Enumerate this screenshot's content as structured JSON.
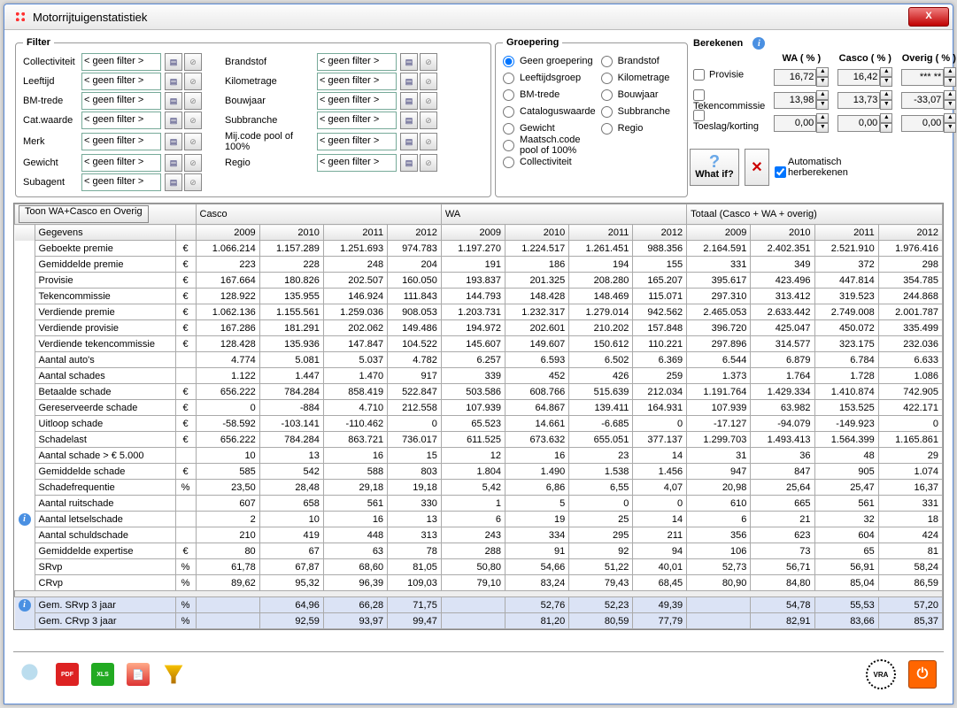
{
  "window": {
    "title": "Motorrijtuigenstatistiek"
  },
  "filter": {
    "legend": "Filter",
    "none": "< geen filter >",
    "left": [
      "Collectiviteit",
      "Leeftijd",
      "BM-trede",
      "Cat.waarde",
      "Merk",
      "Gewicht",
      "Subagent"
    ],
    "right": [
      "Brandstof",
      "Kilometrage",
      "Bouwjaar",
      "Subbranche",
      "Mij.code pool of 100%",
      "Regio"
    ]
  },
  "group": {
    "legend": "Groepering",
    "options": [
      "Geen groepering",
      "Leeftijdsgroep",
      "BM-trede",
      "Cataloguswaarde",
      "Gewicht",
      "Maatsch.code pool of 100%",
      "Collectiviteit",
      "Brandstof",
      "Kilometrage",
      "Bouwjaar",
      "Subbranche",
      "Regio"
    ],
    "selected": "Geen groepering"
  },
  "calc": {
    "legend": "Berekenen",
    "rows": [
      "Provisie",
      "Tekencommissie",
      "Toeslag/korting"
    ],
    "cols": [
      "WA ( % )",
      "Casco ( % )",
      "Overig ( % )"
    ],
    "vals": [
      [
        "16,72",
        "16,42",
        "*** **"
      ],
      [
        "13,98",
        "13,73",
        "-33,07"
      ],
      [
        "0,00",
        "0,00",
        "0,00"
      ]
    ],
    "whatif": "What if?",
    "auto": "Automatisch herberekenen"
  },
  "table": {
    "toggle": "Toon WA+Casco en Overig",
    "groups": [
      "Casco",
      "WA",
      "Totaal (Casco + WA + overig)"
    ],
    "years": [
      "2009",
      "2010",
      "2011",
      "2012"
    ],
    "row_header": "Gegevens",
    "rows": [
      {
        "name": "Geboekte premie",
        "unit": "€",
        "casco": [
          "1.066.214",
          "1.157.289",
          "1.251.693",
          "974.783"
        ],
        "wa": [
          "1.197.270",
          "1.224.517",
          "1.261.451",
          "988.356"
        ],
        "tot": [
          "2.164.591",
          "2.402.351",
          "2.521.910",
          "1.976.416"
        ]
      },
      {
        "name": "Gemiddelde premie",
        "unit": "€",
        "casco": [
          "223",
          "228",
          "248",
          "204"
        ],
        "wa": [
          "191",
          "186",
          "194",
          "155"
        ],
        "tot": [
          "331",
          "349",
          "372",
          "298"
        ]
      },
      {
        "name": "Provisie",
        "unit": "€",
        "casco": [
          "167.664",
          "180.826",
          "202.507",
          "160.050"
        ],
        "wa": [
          "193.837",
          "201.325",
          "208.280",
          "165.207"
        ],
        "tot": [
          "395.617",
          "423.496",
          "447.814",
          "354.785"
        ]
      },
      {
        "name": "Tekencommissie",
        "unit": "€",
        "casco": [
          "128.922",
          "135.955",
          "146.924",
          "111.843"
        ],
        "wa": [
          "144.793",
          "148.428",
          "148.469",
          "115.071"
        ],
        "tot": [
          "297.310",
          "313.412",
          "319.523",
          "244.868"
        ]
      },
      {
        "name": "Verdiende premie",
        "unit": "€",
        "casco": [
          "1.062.136",
          "1.155.561",
          "1.259.036",
          "908.053"
        ],
        "wa": [
          "1.203.731",
          "1.232.317",
          "1.279.014",
          "942.562"
        ],
        "tot": [
          "2.465.053",
          "2.633.442",
          "2.749.008",
          "2.001.787"
        ]
      },
      {
        "name": "Verdiende provisie",
        "unit": "€",
        "casco": [
          "167.286",
          "181.291",
          "202.062",
          "149.486"
        ],
        "wa": [
          "194.972",
          "202.601",
          "210.202",
          "157.848"
        ],
        "tot": [
          "396.720",
          "425.047",
          "450.072",
          "335.499"
        ]
      },
      {
        "name": "Verdiende tekencommissie",
        "unit": "€",
        "casco": [
          "128.428",
          "135.936",
          "147.847",
          "104.522"
        ],
        "wa": [
          "145.607",
          "149.607",
          "150.612",
          "110.221"
        ],
        "tot": [
          "297.896",
          "314.577",
          "323.175",
          "232.036"
        ]
      },
      {
        "name": "Aantal auto's",
        "unit": "",
        "casco": [
          "4.774",
          "5.081",
          "5.037",
          "4.782"
        ],
        "wa": [
          "6.257",
          "6.593",
          "6.502",
          "6.369"
        ],
        "tot": [
          "6.544",
          "6.879",
          "6.784",
          "6.633"
        ]
      },
      {
        "name": "Aantal schades",
        "unit": "",
        "casco": [
          "1.122",
          "1.447",
          "1.470",
          "917"
        ],
        "wa": [
          "339",
          "452",
          "426",
          "259"
        ],
        "tot": [
          "1.373",
          "1.764",
          "1.728",
          "1.086"
        ]
      },
      {
        "name": "Betaalde schade",
        "unit": "€",
        "casco": [
          "656.222",
          "784.284",
          "858.419",
          "522.847"
        ],
        "wa": [
          "503.586",
          "608.766",
          "515.639",
          "212.034"
        ],
        "tot": [
          "1.191.764",
          "1.429.334",
          "1.410.874",
          "742.905"
        ]
      },
      {
        "name": "Gereserveerde schade",
        "unit": "€",
        "casco": [
          "0",
          "-884",
          "4.710",
          "212.558"
        ],
        "wa": [
          "107.939",
          "64.867",
          "139.411",
          "164.931"
        ],
        "tot": [
          "107.939",
          "63.982",
          "153.525",
          "422.171"
        ]
      },
      {
        "name": "Uitloop schade",
        "unit": "€",
        "casco": [
          "-58.592",
          "-103.141",
          "-110.462",
          "0"
        ],
        "wa": [
          "65.523",
          "14.661",
          "-6.685",
          "0"
        ],
        "tot": [
          "-17.127",
          "-94.079",
          "-149.923",
          "0"
        ]
      },
      {
        "name": "Schadelast",
        "unit": "€",
        "casco": [
          "656.222",
          "784.284",
          "863.721",
          "736.017"
        ],
        "wa": [
          "611.525",
          "673.632",
          "655.051",
          "377.137"
        ],
        "tot": [
          "1.299.703",
          "1.493.413",
          "1.564.399",
          "1.165.861"
        ]
      },
      {
        "name": "Aantal schade > € 5.000",
        "unit": "",
        "casco": [
          "10",
          "13",
          "16",
          "15"
        ],
        "wa": [
          "12",
          "16",
          "23",
          "14"
        ],
        "tot": [
          "31",
          "36",
          "48",
          "29"
        ]
      },
      {
        "name": "Gemiddelde schade",
        "unit": "€",
        "casco": [
          "585",
          "542",
          "588",
          "803"
        ],
        "wa": [
          "1.804",
          "1.490",
          "1.538",
          "1.456"
        ],
        "tot": [
          "947",
          "847",
          "905",
          "1.074"
        ]
      },
      {
        "name": "Schadefrequentie",
        "unit": "%",
        "casco": [
          "23,50",
          "28,48",
          "29,18",
          "19,18"
        ],
        "wa": [
          "5,42",
          "6,86",
          "6,55",
          "4,07"
        ],
        "tot": [
          "20,98",
          "25,64",
          "25,47",
          "16,37"
        ]
      },
      {
        "name": "Aantal ruitschade",
        "unit": "",
        "casco": [
          "607",
          "658",
          "561",
          "330"
        ],
        "wa": [
          "1",
          "5",
          "0",
          "0"
        ],
        "tot": [
          "610",
          "665",
          "561",
          "331"
        ]
      },
      {
        "name": "Aantal letselschade",
        "unit": "",
        "info": true,
        "casco": [
          "2",
          "10",
          "16",
          "13"
        ],
        "wa": [
          "6",
          "19",
          "25",
          "14"
        ],
        "tot": [
          "6",
          "21",
          "32",
          "18"
        ]
      },
      {
        "name": "Aantal schuldschade",
        "unit": "",
        "casco": [
          "210",
          "419",
          "448",
          "313"
        ],
        "wa": [
          "243",
          "334",
          "295",
          "211"
        ],
        "tot": [
          "356",
          "623",
          "604",
          "424"
        ]
      },
      {
        "name": "Gemiddelde expertise",
        "unit": "€",
        "casco": [
          "80",
          "67",
          "63",
          "78"
        ],
        "wa": [
          "288",
          "91",
          "92",
          "94"
        ],
        "tot": [
          "106",
          "73",
          "65",
          "81"
        ]
      },
      {
        "name": "SRvp",
        "unit": "%",
        "casco": [
          "61,78",
          "67,87",
          "68,60",
          "81,05"
        ],
        "wa": [
          "50,80",
          "54,66",
          "51,22",
          "40,01"
        ],
        "tot": [
          "52,73",
          "56,71",
          "56,91",
          "58,24"
        ]
      },
      {
        "name": "CRvp",
        "unit": "%",
        "casco": [
          "89,62",
          "95,32",
          "96,39",
          "109,03"
        ],
        "wa": [
          "79,10",
          "83,24",
          "79,43",
          "68,45"
        ],
        "tot": [
          "80,90",
          "84,80",
          "85,04",
          "86,59"
        ]
      }
    ],
    "footer_rows": [
      {
        "name": "Gem. SRvp 3 jaar",
        "unit": "%",
        "info": true,
        "casco": [
          "",
          "64,96",
          "66,28",
          "71,75"
        ],
        "wa": [
          "",
          "52,76",
          "52,23",
          "49,39"
        ],
        "tot": [
          "",
          "54,78",
          "55,53",
          "57,20"
        ]
      },
      {
        "name": "Gem. CRvp 3 jaar",
        "unit": "%",
        "casco": [
          "",
          "92,59",
          "93,97",
          "99,47"
        ],
        "wa": [
          "",
          "81,20",
          "80,59",
          "77,79"
        ],
        "tot": [
          "",
          "82,91",
          "83,66",
          "85,37"
        ]
      }
    ]
  }
}
